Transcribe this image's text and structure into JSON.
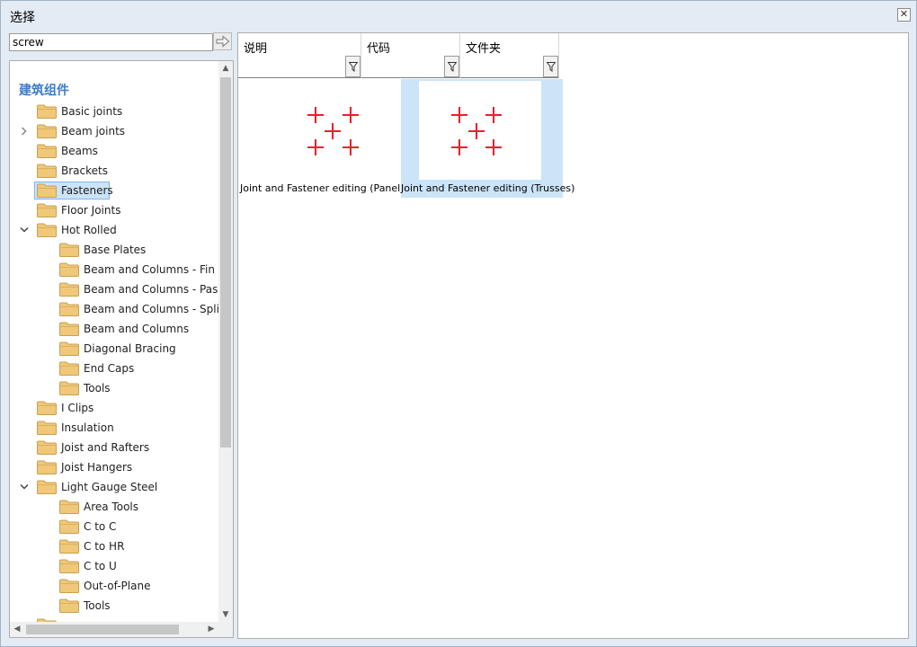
{
  "window": {
    "title": "选择"
  },
  "search": {
    "value": "screw"
  },
  "tree": {
    "root_label": "建筑组件",
    "items": [
      {
        "label": "Basic joints",
        "level": 1,
        "toggle": "",
        "selected": false
      },
      {
        "label": "Beam joints",
        "level": 1,
        "toggle": ">",
        "selected": false
      },
      {
        "label": "Beams",
        "level": 1,
        "toggle": "",
        "selected": false
      },
      {
        "label": "Brackets",
        "level": 1,
        "toggle": "",
        "selected": false
      },
      {
        "label": "Fasteners",
        "level": 1,
        "toggle": "",
        "selected": true
      },
      {
        "label": "Floor Joints",
        "level": 1,
        "toggle": "",
        "selected": false
      },
      {
        "label": "Hot Rolled",
        "level": 1,
        "toggle": "v",
        "selected": false
      },
      {
        "label": "Base Plates",
        "level": 2,
        "toggle": "",
        "selected": false
      },
      {
        "label": "Beam and Columns - Fin Plate",
        "level": 2,
        "toggle": "",
        "selected": false
      },
      {
        "label": "Beam and Columns - Passing",
        "level": 2,
        "toggle": "",
        "selected": false
      },
      {
        "label": "Beam and Columns - Splice",
        "level": 2,
        "toggle": "",
        "selected": false
      },
      {
        "label": "Beam and Columns",
        "level": 2,
        "toggle": "",
        "selected": false
      },
      {
        "label": "Diagonal Bracing",
        "level": 2,
        "toggle": "",
        "selected": false
      },
      {
        "label": "End Caps",
        "level": 2,
        "toggle": "",
        "selected": false
      },
      {
        "label": "Tools",
        "level": 2,
        "toggle": "",
        "selected": false
      },
      {
        "label": "I Clips",
        "level": 1,
        "toggle": "",
        "selected": false
      },
      {
        "label": "Insulation",
        "level": 1,
        "toggle": "",
        "selected": false
      },
      {
        "label": "Joist and Rafters",
        "level": 1,
        "toggle": "",
        "selected": false
      },
      {
        "label": "Joist Hangers",
        "level": 1,
        "toggle": "",
        "selected": false
      },
      {
        "label": "Light Gauge Steel",
        "level": 1,
        "toggle": "v",
        "selected": false
      },
      {
        "label": "Area Tools",
        "level": 2,
        "toggle": "",
        "selected": false
      },
      {
        "label": "C to C",
        "level": 2,
        "toggle": "",
        "selected": false
      },
      {
        "label": "C to HR",
        "level": 2,
        "toggle": "",
        "selected": false
      },
      {
        "label": "C to U",
        "level": 2,
        "toggle": "",
        "selected": false
      },
      {
        "label": "Out-of-Plane",
        "level": 2,
        "toggle": "",
        "selected": false
      },
      {
        "label": "Tools",
        "level": 2,
        "toggle": "",
        "selected": false
      },
      {
        "label": "",
        "level": 1,
        "toggle": "",
        "selected": false
      }
    ]
  },
  "columns": [
    {
      "label": "说明"
    },
    {
      "label": "代码"
    },
    {
      "label": "文件夹"
    }
  ],
  "results": [
    {
      "caption": "Joint and Fastener editing (Panels)",
      "selected": false
    },
    {
      "caption": "Joint and Fastener editing (Trusses)",
      "selected": true
    }
  ],
  "icons": {
    "close": "close-icon",
    "go": "arrow-right-icon",
    "folder": "folder-icon",
    "filter": "filter-icon",
    "component": "component-crosses-icon"
  },
  "colors": {
    "accent": "#3c7cc8",
    "selection": "#cce4f8",
    "folder": "#f0c87a",
    "cross": "#e8202a"
  }
}
